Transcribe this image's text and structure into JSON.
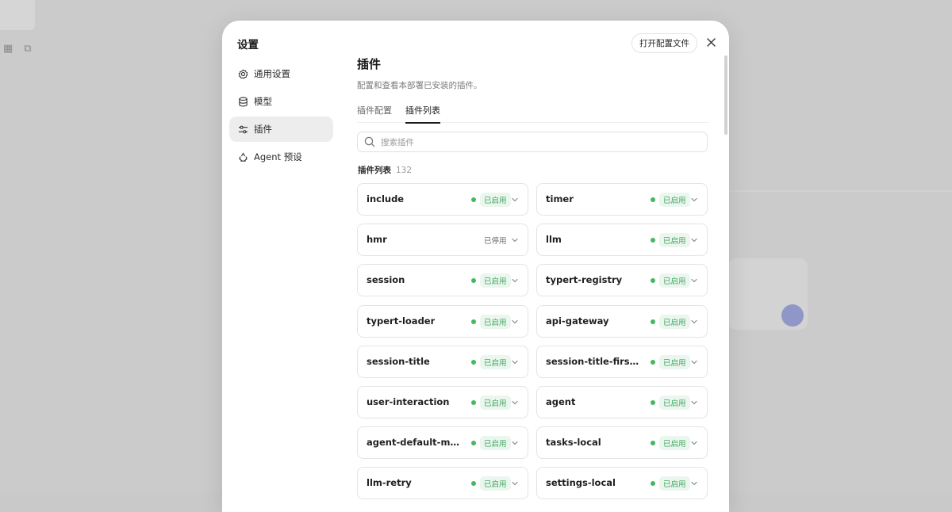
{
  "settings": {
    "title": "设置"
  },
  "nav": {
    "items": [
      {
        "label": "通用设置",
        "icon": "gear-icon",
        "active": false
      },
      {
        "label": "模型",
        "icon": "database-icon",
        "active": false
      },
      {
        "label": "插件",
        "icon": "sliders-icon",
        "active": true
      },
      {
        "label": "Agent 预设",
        "icon": "agent-icon",
        "active": false
      }
    ]
  },
  "header": {
    "open_config_label": "打开配置文件",
    "close_icon": "close-icon"
  },
  "page": {
    "title": "插件",
    "description": "配置和查看本部署已安装的插件。"
  },
  "tabs": [
    {
      "label": "插件配置",
      "active": false
    },
    {
      "label": "插件列表",
      "active": true
    }
  ],
  "search": {
    "placeholder": "搜索插件",
    "icon": "search-icon"
  },
  "plugin_list": {
    "heading": "插件列表",
    "count": "132",
    "plugins": [
      {
        "name": "include",
        "status": "已启用",
        "enabled": true
      },
      {
        "name": "timer",
        "status": "已启用",
        "enabled": true
      },
      {
        "name": "hmr",
        "status": "已停用",
        "enabled": false
      },
      {
        "name": "llm",
        "status": "已启用",
        "enabled": true
      },
      {
        "name": "session",
        "status": "已启用",
        "enabled": true
      },
      {
        "name": "typert-registry",
        "status": "已启用",
        "enabled": true
      },
      {
        "name": "typert-loader",
        "status": "已启用",
        "enabled": true
      },
      {
        "name": "api-gateway",
        "status": "已启用",
        "enabled": true
      },
      {
        "name": "session-title",
        "status": "已启用",
        "enabled": true
      },
      {
        "name": "session-title-first-m...",
        "status": "已启用",
        "enabled": true
      },
      {
        "name": "user-interaction",
        "status": "已启用",
        "enabled": true
      },
      {
        "name": "agent",
        "status": "已启用",
        "enabled": true
      },
      {
        "name": "agent-default-model",
        "status": "已启用",
        "enabled": true
      },
      {
        "name": "tasks-local",
        "status": "已启用",
        "enabled": true
      },
      {
        "name": "llm-retry",
        "status": "已启用",
        "enabled": true
      },
      {
        "name": "settings-local",
        "status": "已启用",
        "enabled": true
      }
    ]
  },
  "colors": {
    "enabled_green": "#43b764",
    "enabled_badge_bg": "#eaf6ee",
    "overlay": "#c9c9c9"
  }
}
